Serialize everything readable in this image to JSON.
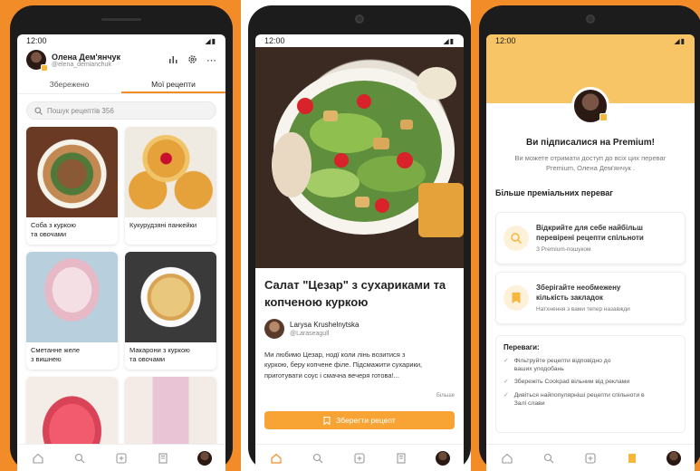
{
  "colors": {
    "accent": "#f28c28",
    "premium": "#f7c566",
    "button": "#f7a435"
  },
  "status_time": "12:00",
  "screen1": {
    "user_name": "Олена Дем'янчук",
    "user_handle": "@elena_demianchuk",
    "tabs": [
      "Збережено",
      "Мої рецепти"
    ],
    "active_tab": "Мої рецепти",
    "search_placeholder": "Пошук рецептів 356",
    "recipes": [
      {
        "title": "Соба з куркою та овочами",
        "line1": "Соба з куркою",
        "line2": "та овочами"
      },
      {
        "title": "Кукурудзяні панкейки",
        "line1": "Кукурудзяні панкейки",
        "line2": ""
      },
      {
        "title": "Сметанне желе з вишнею",
        "line1": "Сметанне желе",
        "line2": "з вишнею"
      },
      {
        "title": "Макарони з куркою та овочами",
        "line1": "Макарони з куркою",
        "line2": "та овочами"
      },
      {
        "title": "",
        "line1": "",
        "line2": ""
      },
      {
        "title": "",
        "line1": "",
        "line2": ""
      }
    ]
  },
  "screen2": {
    "title_line1": "Салат \"Цезар\" з сухариками та",
    "title_line2": "копченою куркою",
    "author_name": "Larysa Krushelnytska",
    "author_handle": "@Laraseagull",
    "desc_line1": "Ми любимо Цезар, нодї коли лінь возитися з",
    "desc_line2": "куркою, беру копчене філе. Підсмажити сухарики,",
    "desc_line3": "приготувати соус і смачна вечеря готова!...",
    "more_label": "Більше",
    "save_label": "Зберегти рецепт"
  },
  "screen3": {
    "title": "Ви підписалися на Premium!",
    "subtitle_line1": "Ви можете отримати доступ до всіх цих переваг",
    "subtitle_line2": "Premium, Олена Дем'янчук .",
    "section_title": "Більше преміальних переваг",
    "features": [
      {
        "line1": "Відкрийте для себе найбільш",
        "line2": "перевірені рецепти спільноти",
        "sub": "З Premium-пошуком",
        "icon": "search-icon"
      },
      {
        "line1": "Зберігайте необмежену",
        "line2": "кількість закладок",
        "sub": "Натхнення з вами тепер назавжди",
        "icon": "bookmark-icon"
      }
    ],
    "advantages_title": "Переваги:",
    "advantages": [
      {
        "line1": "Фільтруйте рецепти відповідно до",
        "line2": "ваших уподобань"
      },
      {
        "line1": "Збережіть Cookpad вільним від реклами",
        "line2": ""
      },
      {
        "line1": "Дивіться найпопулярніші рецепти спільноти в",
        "line2": "Залі слави"
      }
    ]
  }
}
